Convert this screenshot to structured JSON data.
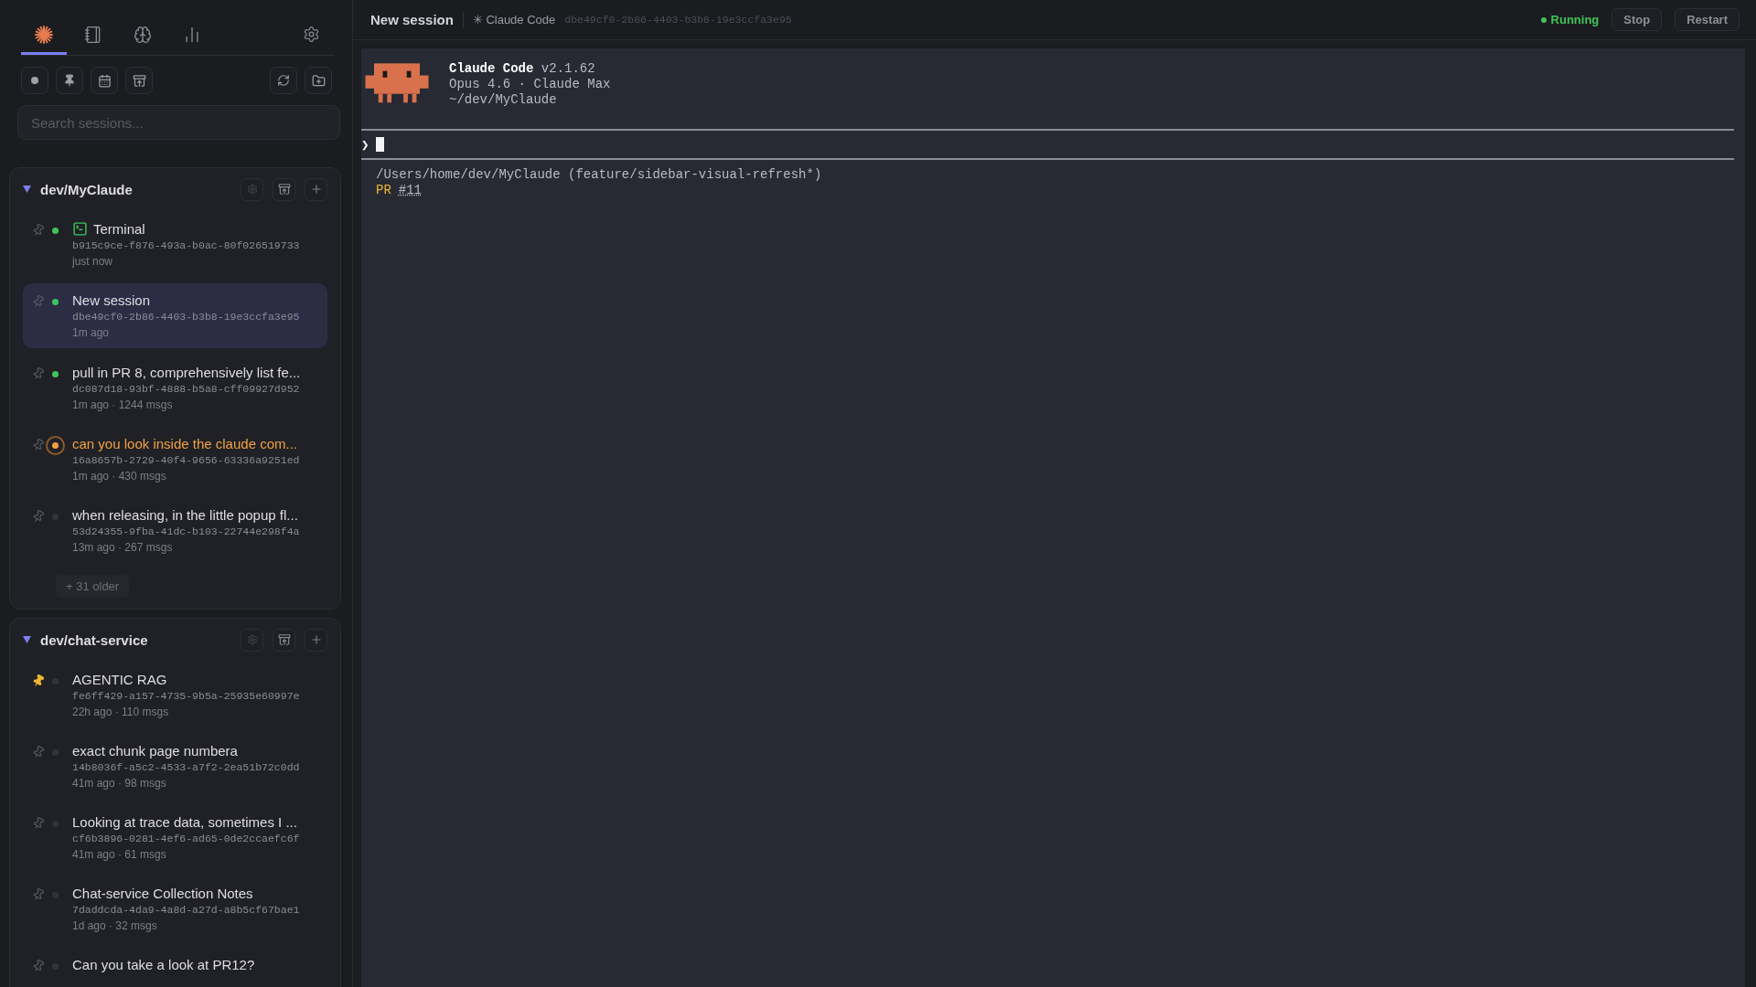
{
  "sidebar": {
    "tabs": [
      {
        "kind": "sessions",
        "selected": true
      },
      {
        "kind": "notes",
        "selected": false
      },
      {
        "kind": "memory",
        "selected": false
      },
      {
        "kind": "stats",
        "selected": false
      }
    ],
    "search": {
      "placeholder": "Search sessions..."
    },
    "groups": [
      {
        "name": "dev/MyClaude",
        "expanded": true,
        "more": "+ 31 older",
        "sessions": [
          {
            "kind": "terminal",
            "title": "Terminal",
            "id": "b915c9ce-f876-493a-b0ac-80f026519733",
            "meta": "just now",
            "color": "#3ec45a",
            "attention": false,
            "pinned": false,
            "selected": false
          },
          {
            "kind": "chat",
            "title": "New session",
            "id": "dbe49cf0-2b86-4403-b3b8-19e3ccfa3e95",
            "meta": "1m ago",
            "color": "#3ec45a",
            "attention": false,
            "pinned": false,
            "selected": true
          },
          {
            "kind": "chat",
            "title": "pull in PR 8, comprehensively list fe...",
            "id": "dc087d18-93bf-4888-b5a8-cff09927d952",
            "meta": "1m ago · 1244 msgs",
            "color": "#3ec45a",
            "attention": false,
            "pinned": false,
            "selected": false
          },
          {
            "kind": "chat",
            "title": "can you look inside the claude com...",
            "id": "16a8657b-2729-40f4-9656-63336a9251ed",
            "meta": "1m ago · 430 msgs",
            "color": "#f0a040",
            "attention": true,
            "pinned": false,
            "selected": false
          },
          {
            "kind": "chat",
            "title": "when releasing, in the little popup fl...",
            "id": "53d24355-9fba-41dc-b103-22744e298f4a",
            "meta": "13m ago · 267 msgs",
            "color": "#33343a",
            "attention": false,
            "pinned": false,
            "selected": false
          }
        ]
      },
      {
        "name": "dev/chat-service",
        "expanded": true,
        "sessions": [
          {
            "kind": "chat",
            "title": "AGENTIC RAG",
            "id": "fe6ff429-a157-4735-9b5a-25935e60997e",
            "meta": "22h ago · 110 msgs",
            "color": "#33343a",
            "attention": false,
            "pinned": true,
            "selected": false
          },
          {
            "kind": "chat",
            "title": "exact chunk page numbera",
            "id": "14b8036f-a5c2-4533-a7f2-2ea51b72c0dd",
            "meta": "41m ago · 98 msgs",
            "color": "#33343a",
            "attention": false,
            "pinned": false,
            "selected": false
          },
          {
            "kind": "chat",
            "title": "Looking at trace data, sometimes I ...",
            "id": "cf6b3896-0281-4ef6-ad65-0de2ccaefc6f",
            "meta": "41m ago · 61 msgs",
            "color": "#33343a",
            "attention": false,
            "pinned": false,
            "selected": false
          },
          {
            "kind": "chat",
            "title": "Chat-service Collection Notes",
            "id": "7daddcda-4da9-4a8d-a27d-a8b5cf67bae1",
            "meta": "1d ago · 32 msgs",
            "color": "#33343a",
            "attention": false,
            "pinned": false,
            "selected": false
          },
          {
            "kind": "chat",
            "title": "Can you take a look at PR12?",
            "color": "#33343a",
            "attention": false,
            "pinned": false,
            "selected": false
          }
        ]
      }
    ]
  },
  "header": {
    "title": "New session",
    "agent": "✳ Claude Code",
    "session_id": "dbe49cf0-2b86-4403-b3b8-19e3ccfa3e95",
    "status": "Running",
    "running": true,
    "buttons": [
      "Stop",
      "Restart"
    ]
  },
  "terminal": {
    "app_name": "Claude Code",
    "version": "v2.1.62",
    "model": "Opus 4.6 · Claude Max",
    "cwd": "~/dev/MyClaude",
    "prompt": "❯",
    "path": "/Users/home/dev/MyClaude (feature/sidebar-visual-refresh*)",
    "pr_label": "PR",
    "pr_number": "#11"
  }
}
